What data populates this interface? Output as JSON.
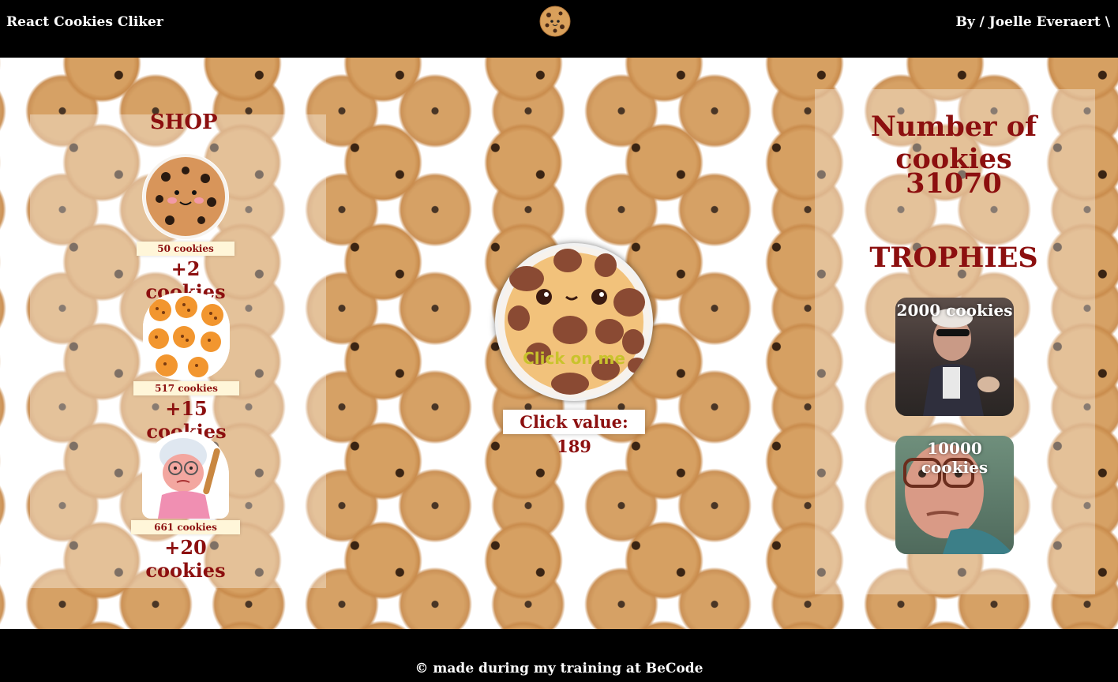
{
  "header": {
    "title": "React Cookies Cliker",
    "author": "By / Joelle Everaert \\"
  },
  "shop": {
    "title": "SHOP",
    "items": [
      {
        "price": "50 cookies",
        "bonus": "+2 cookies",
        "icon": "happy-cookie-icon"
      },
      {
        "price": "517 cookies",
        "bonus": "+15 cookies",
        "icon": "cookie-pile-icon"
      },
      {
        "price": "661 cookies",
        "bonus": "+20 cookies",
        "icon": "grandma-icon"
      }
    ]
  },
  "clicker": {
    "label": "Click on me",
    "click_value": "Click value: 189"
  },
  "stats": {
    "count_title": "Number of cookies",
    "count_value": "31070",
    "trophies_title": "TROPHIES",
    "trophies": [
      {
        "label": "2000 cookies"
      },
      {
        "label": "10000 cookies"
      }
    ]
  },
  "footer": {
    "text": "© made during my training at BeCode"
  },
  "colors": {
    "accent": "#8c0f0f",
    "header_bg": "#000000",
    "click_text": "#c9c32c"
  }
}
